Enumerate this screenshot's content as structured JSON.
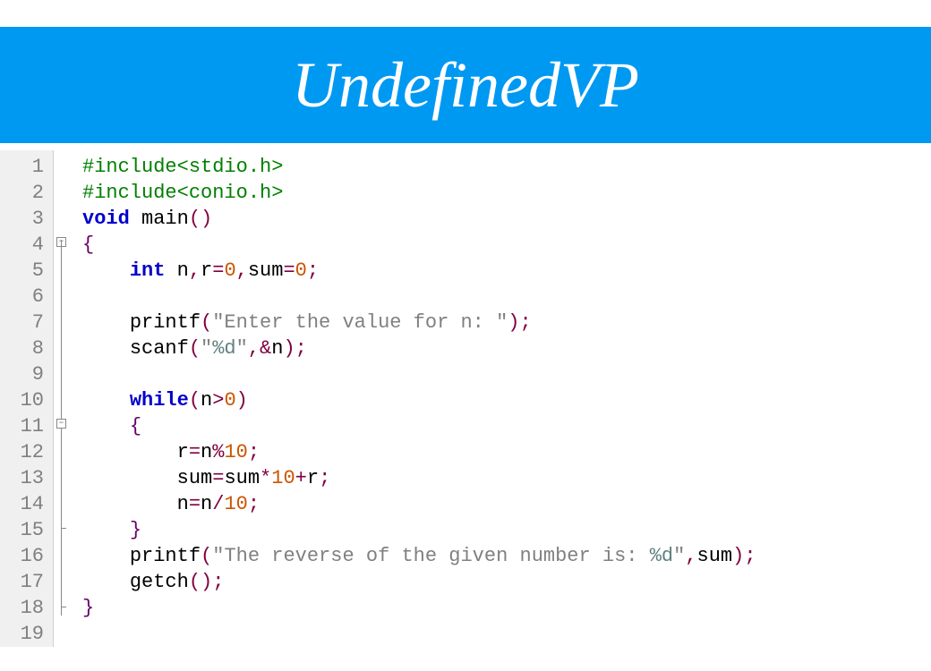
{
  "header": {
    "title": "UndefinedVP"
  },
  "lineNumbers": [
    "1",
    "2",
    "3",
    "4",
    "5",
    "6",
    "7",
    "8",
    "9",
    "10",
    "11",
    "12",
    "13",
    "14",
    "15",
    "16",
    "17",
    "18",
    "19"
  ],
  "code": {
    "l1": {
      "pp": "#include<stdio.h>"
    },
    "l2": {
      "pp": "#include<conio.h>"
    },
    "l3": {
      "kw": "void",
      "sp": " ",
      "id1": "main",
      "open": "(",
      "close": ")"
    },
    "l4": {
      "br": "{"
    },
    "l5": {
      "pad": "    ",
      "kw": "int",
      "sp": " ",
      "id1": "n",
      "op1": ",",
      "id2": "r",
      "op2": "=",
      "n1": "0",
      "op3": ",",
      "id3": "sum",
      "op4": "=",
      "n2": "0",
      "op5": ";"
    },
    "l6": {
      "pad": "    "
    },
    "l7": {
      "pad": "    ",
      "id": "printf",
      "open": "(",
      "str": "\"Enter the value for n: \"",
      "close": ")",
      "semi": ";"
    },
    "l8": {
      "pad": "    ",
      "id": "scanf",
      "open": "(",
      "q1": "\"",
      "fmt": "%d",
      "q2": "\"",
      "op1": ",",
      "op2": "&",
      "id2": "n",
      "close": ")",
      "semi": ";"
    },
    "l9": {
      "pad": "    "
    },
    "l10": {
      "pad": "    ",
      "kw": "while",
      "open": "(",
      "id": "n",
      "op": ">",
      "n": "0",
      "close": ")"
    },
    "l11": {
      "pad": "    ",
      "br": "{"
    },
    "l12": {
      "pad": "        ",
      "id1": "r",
      "op1": "=",
      "id2": "n",
      "op2": "%",
      "n": "10",
      "semi": ";"
    },
    "l13": {
      "pad": "        ",
      "id1": "sum",
      "op1": "=",
      "id2": "sum",
      "op2": "*",
      "n1": "10",
      "op3": "+",
      "id3": "r",
      "semi": ";"
    },
    "l14": {
      "pad": "        ",
      "id1": "n",
      "op1": "=",
      "id2": "n",
      "op2": "/",
      "n": "10",
      "semi": ";"
    },
    "l15": {
      "pad": "    ",
      "br": "}"
    },
    "l16": {
      "pad": "    ",
      "id": "printf",
      "open": "(",
      "q1": "\"",
      "s1": "The reverse of the given number is: ",
      "fmt": "%d",
      "q2": "\"",
      "op": ",",
      "id2": "sum",
      "close": ")",
      "semi": ";"
    },
    "l17": {
      "pad": "    ",
      "id": "getch",
      "open": "(",
      "close": ")",
      "semi": ";"
    },
    "l18": {
      "br": "}"
    }
  }
}
